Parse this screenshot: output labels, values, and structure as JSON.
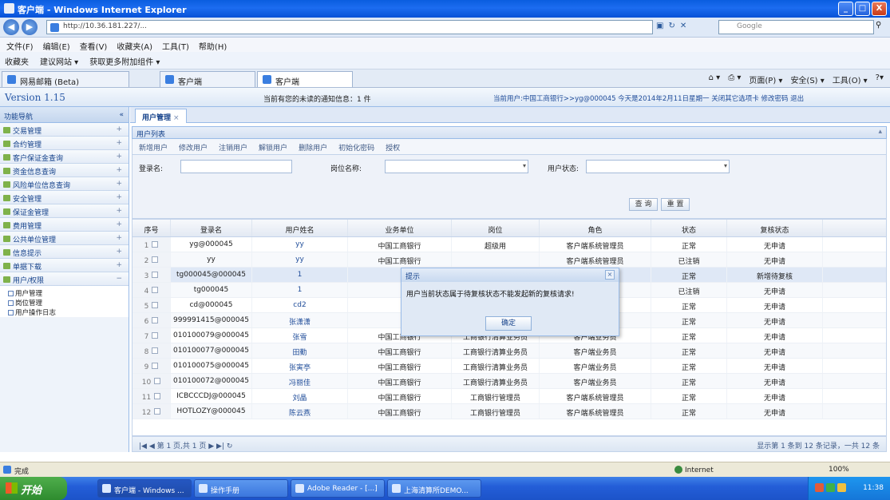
{
  "window": {
    "title": "客户端 - Windows Internet Explorer",
    "controls": [
      "_",
      "□",
      "X"
    ]
  },
  "address": {
    "url": "http://10.36.181.227/...",
    "search_placeholder": "Google"
  },
  "menu": [
    "文件(F)",
    "编辑(E)",
    "查看(V)",
    "收藏夹(A)",
    "工具(T)",
    "帮助(H)"
  ],
  "favorites": [
    "收藏夹",
    "建议网站 ▾",
    "获取更多附加组件 ▾"
  ],
  "ie_tabs": [
    "网易邮箱 (Beta)",
    "客户端",
    "客户端"
  ],
  "ie_commands": [
    "页面(P) ▾",
    "安全(S) ▾",
    "工具(O) ▾"
  ],
  "app": {
    "version": "Version 1.15",
    "notice": "当前有您的未读的通知信息：1 件",
    "userinfo": "当前用户:中国工商银行>>yg@000045 今天是2014年2月11日星期一 关闭其它选项卡 修改密码 退出"
  },
  "sidebar": {
    "title": "功能导航",
    "items": [
      {
        "label": "交易管理",
        "expander": "+"
      },
      {
        "label": "合约管理",
        "expander": "+"
      },
      {
        "label": "客户保证金查询",
        "expander": "+"
      },
      {
        "label": "资金信息查询",
        "expander": "+"
      },
      {
        "label": "风险单位信息查询",
        "expander": "+"
      },
      {
        "label": "安全管理",
        "expander": "+"
      },
      {
        "label": "保证金管理",
        "expander": "+"
      },
      {
        "label": "费用管理",
        "expander": "+"
      },
      {
        "label": "公共单位管理",
        "expander": "+"
      },
      {
        "label": "信息提示",
        "expander": "+"
      },
      {
        "label": "单据下载",
        "expander": "+"
      },
      {
        "label": "用户/权限",
        "expander": "−"
      }
    ],
    "subitems": [
      "用户管理",
      "岗位管理",
      "用户操作日志"
    ]
  },
  "main": {
    "tab": "用户管理",
    "panel_title": "用户列表",
    "toolbar": [
      "新增用户",
      "修改用户",
      "注销用户",
      "解锁用户",
      "删除用户",
      "初始化密码",
      "授权"
    ],
    "form": {
      "login_label": "登录名:",
      "position_label": "岗位名称:",
      "status_label": "用户状态:",
      "query_button": "查 询",
      "reset_button": "重 置"
    },
    "grid": {
      "columns": [
        "序号",
        "登录名",
        "用户姓名",
        "业务单位",
        "岗位",
        "角色",
        "状态",
        "复核状态"
      ],
      "rows": [
        [
          "1",
          "yg@000045",
          "yy",
          "中国工商银行",
          "超级用",
          "客户端系统管理员",
          "正常",
          "无申请"
        ],
        [
          "2",
          "yy",
          "yy",
          "中国工商银行",
          "",
          "客户端系统管理员",
          "已注销",
          "无申请"
        ],
        [
          "3",
          "tg000045@000045",
          "1",
          "",
          "",
          "业务员",
          "正常",
          "新增待复核"
        ],
        [
          "4",
          "tg000045",
          "1",
          "",
          "",
          "业务员",
          "已注销",
          "无申请"
        ],
        [
          "5",
          "cd@000045",
          "cd2",
          "",
          "",
          "管理员",
          "正常",
          "无申请"
        ],
        [
          "6",
          "999991415@000045",
          "张潇潇",
          "",
          "",
          "业务员",
          "正常",
          "无申请"
        ],
        [
          "7",
          "010100079@000045",
          "张雪",
          "中国工商银行",
          "工商银行清算业务员",
          "客户端业务员",
          "正常",
          "无申请"
        ],
        [
          "8",
          "010100077@000045",
          "田勤",
          "中国工商银行",
          "工商银行清算业务员",
          "客户端业务员",
          "正常",
          "无申请"
        ],
        [
          "9",
          "010100075@000045",
          "张寅亭",
          "中国工商银行",
          "工商银行清算业务员",
          "客户端业务员",
          "正常",
          "无申请"
        ],
        [
          "10",
          "010100072@000045",
          "冯丽佳",
          "中国工商银行",
          "工商银行清算业务员",
          "客户端业务员",
          "正常",
          "无申请"
        ],
        [
          "11",
          "ICBCCCDJ@000045",
          "刘晶",
          "中国工商银行",
          "工商银行管理员",
          "客户端系统管理员",
          "正常",
          "无申请"
        ],
        [
          "12",
          "HOTLOZY@000045",
          "陈云燕",
          "中国工商银行",
          "工商银行管理员",
          "客户端系统管理员",
          "正常",
          "无申请"
        ]
      ]
    },
    "pager": {
      "left": "第 1 页,共 1 页",
      "right": "显示第 1 条到 12 条记录，一共 12 条"
    }
  },
  "modal": {
    "title": "提示",
    "message": "用户当前状态属于待复核状态不能发起新的复核请求!",
    "ok": "确定",
    "close": "×"
  },
  "status": {
    "text": "完成",
    "zone": "Internet",
    "zoom": "100%"
  },
  "taskbar": {
    "start": "开始",
    "buttons": [
      "客户端 - Windows ...",
      "操作手册",
      "Adobe Reader - [...]",
      "上海清算所DEMO..."
    ],
    "clock": "11:38"
  }
}
